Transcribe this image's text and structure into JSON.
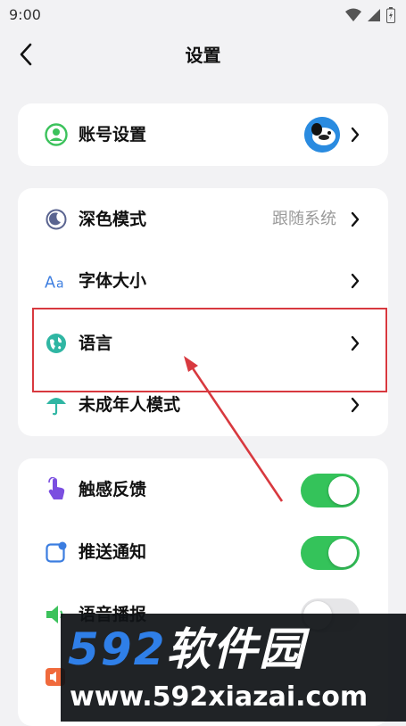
{
  "status_bar": {
    "time": "9:00"
  },
  "header": {
    "title": "设置"
  },
  "account": {
    "label": "账号设置"
  },
  "display": {
    "dark_mode": {
      "label": "深色模式",
      "value": "跟随系统"
    },
    "font_size": {
      "label": "字体大小"
    },
    "language": {
      "label": "语言"
    },
    "minor_mode": {
      "label": "未成年人模式"
    }
  },
  "feedback": {
    "haptic": {
      "label": "触感反馈",
      "enabled": true
    },
    "push": {
      "label": "推送通知",
      "enabled": true
    },
    "voice": {
      "label": "语音播报",
      "enabled": false
    }
  },
  "watermark": {
    "brand_num": "592",
    "brand_cn": "软件园",
    "url": "www.592xiazai.com"
  },
  "colors": {
    "accent": "#34c35a",
    "highlight": "#d8393f",
    "toggle_off": "#e6e6e8"
  }
}
